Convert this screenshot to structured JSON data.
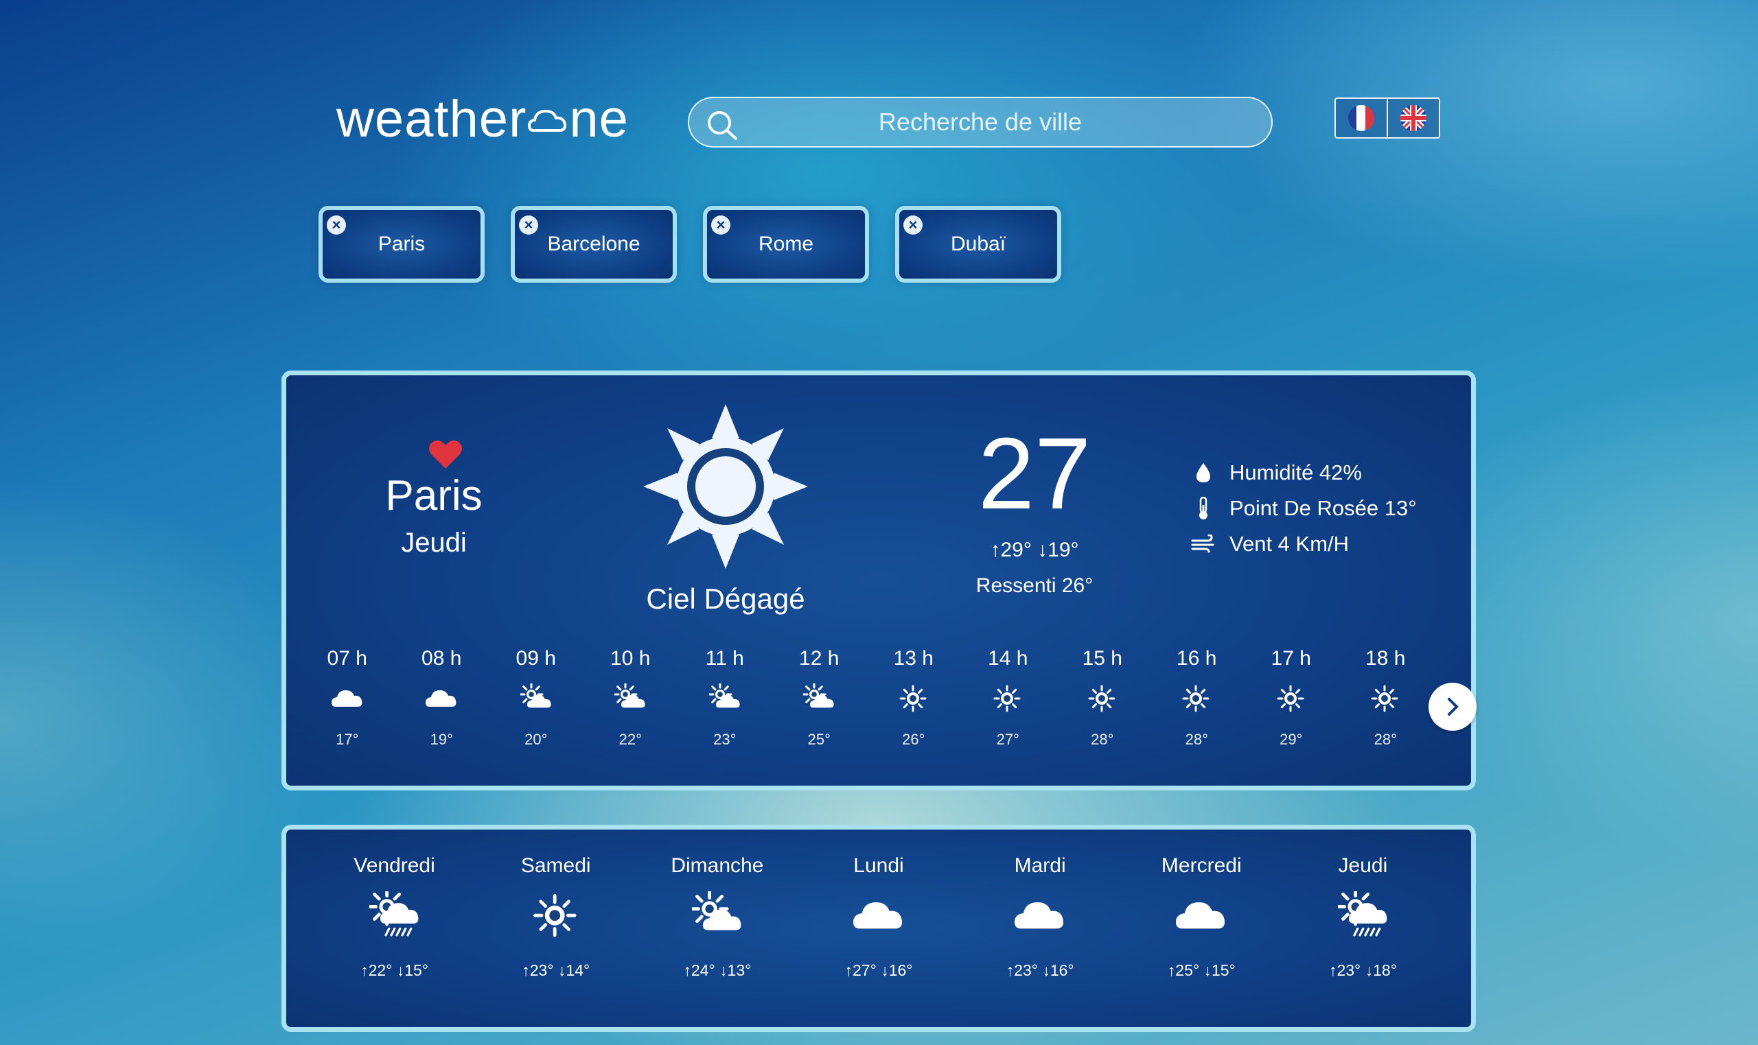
{
  "header": {
    "logo_left": "weather",
    "logo_right": "ne",
    "search_placeholder": "Recherche de ville",
    "languages": [
      {
        "code": "fr",
        "icon": "france-flag-icon"
      },
      {
        "code": "en",
        "icon": "uk-flag-icon"
      }
    ]
  },
  "cities": [
    "Paris",
    "Barcelone",
    "Rome",
    "Dubaï"
  ],
  "current": {
    "city": "Paris",
    "day": "Jeudi",
    "condition": "Ciel Dégagé",
    "temperature": "27",
    "max": "29°",
    "min": "19°",
    "feels_like": "Ressenti 26°",
    "humidity": "Humidité 42%",
    "dew_point": "Point De Rosée 13°",
    "wind": "Vent 4 Km/H"
  },
  "hourly": [
    {
      "hour": "07 h",
      "icon": "cloud",
      "temp": "17°"
    },
    {
      "hour": "08 h",
      "icon": "cloud",
      "temp": "19°"
    },
    {
      "hour": "09 h",
      "icon": "sun-cloud",
      "temp": "20°"
    },
    {
      "hour": "10 h",
      "icon": "sun-cloud",
      "temp": "22°"
    },
    {
      "hour": "11 h",
      "icon": "sun-cloud",
      "temp": "23°"
    },
    {
      "hour": "12 h",
      "icon": "sun-cloud",
      "temp": "25°"
    },
    {
      "hour": "13 h",
      "icon": "sun",
      "temp": "26°"
    },
    {
      "hour": "14 h",
      "icon": "sun",
      "temp": "27°"
    },
    {
      "hour": "15 h",
      "icon": "sun",
      "temp": "28°"
    },
    {
      "hour": "16 h",
      "icon": "sun",
      "temp": "28°"
    },
    {
      "hour": "17 h",
      "icon": "sun",
      "temp": "29°"
    },
    {
      "hour": "18 h",
      "icon": "sun",
      "temp": "28°"
    }
  ],
  "weekly": [
    {
      "day": "Vendredi",
      "icon": "sun-cloud-rain",
      "max": "22°",
      "min": "15°"
    },
    {
      "day": "Samedi",
      "icon": "sun",
      "max": "23°",
      "min": "14°"
    },
    {
      "day": "Dimanche",
      "icon": "sun-cloud",
      "max": "24°",
      "min": "13°"
    },
    {
      "day": "Lundi",
      "icon": "cloud",
      "max": "27°",
      "min": "16°"
    },
    {
      "day": "Mardi",
      "icon": "cloud",
      "max": "23°",
      "min": "16°"
    },
    {
      "day": "Mercredi",
      "icon": "cloud",
      "max": "25°",
      "min": "15°"
    },
    {
      "day": "Jeudi",
      "icon": "sun-cloud-rain",
      "max": "23°",
      "min": "18°"
    }
  ],
  "colors": {
    "card_bg": "#0f3f86",
    "card_border": "#a9e2f0",
    "heart": "#e0343f",
    "sun_ring": "#15427f"
  }
}
